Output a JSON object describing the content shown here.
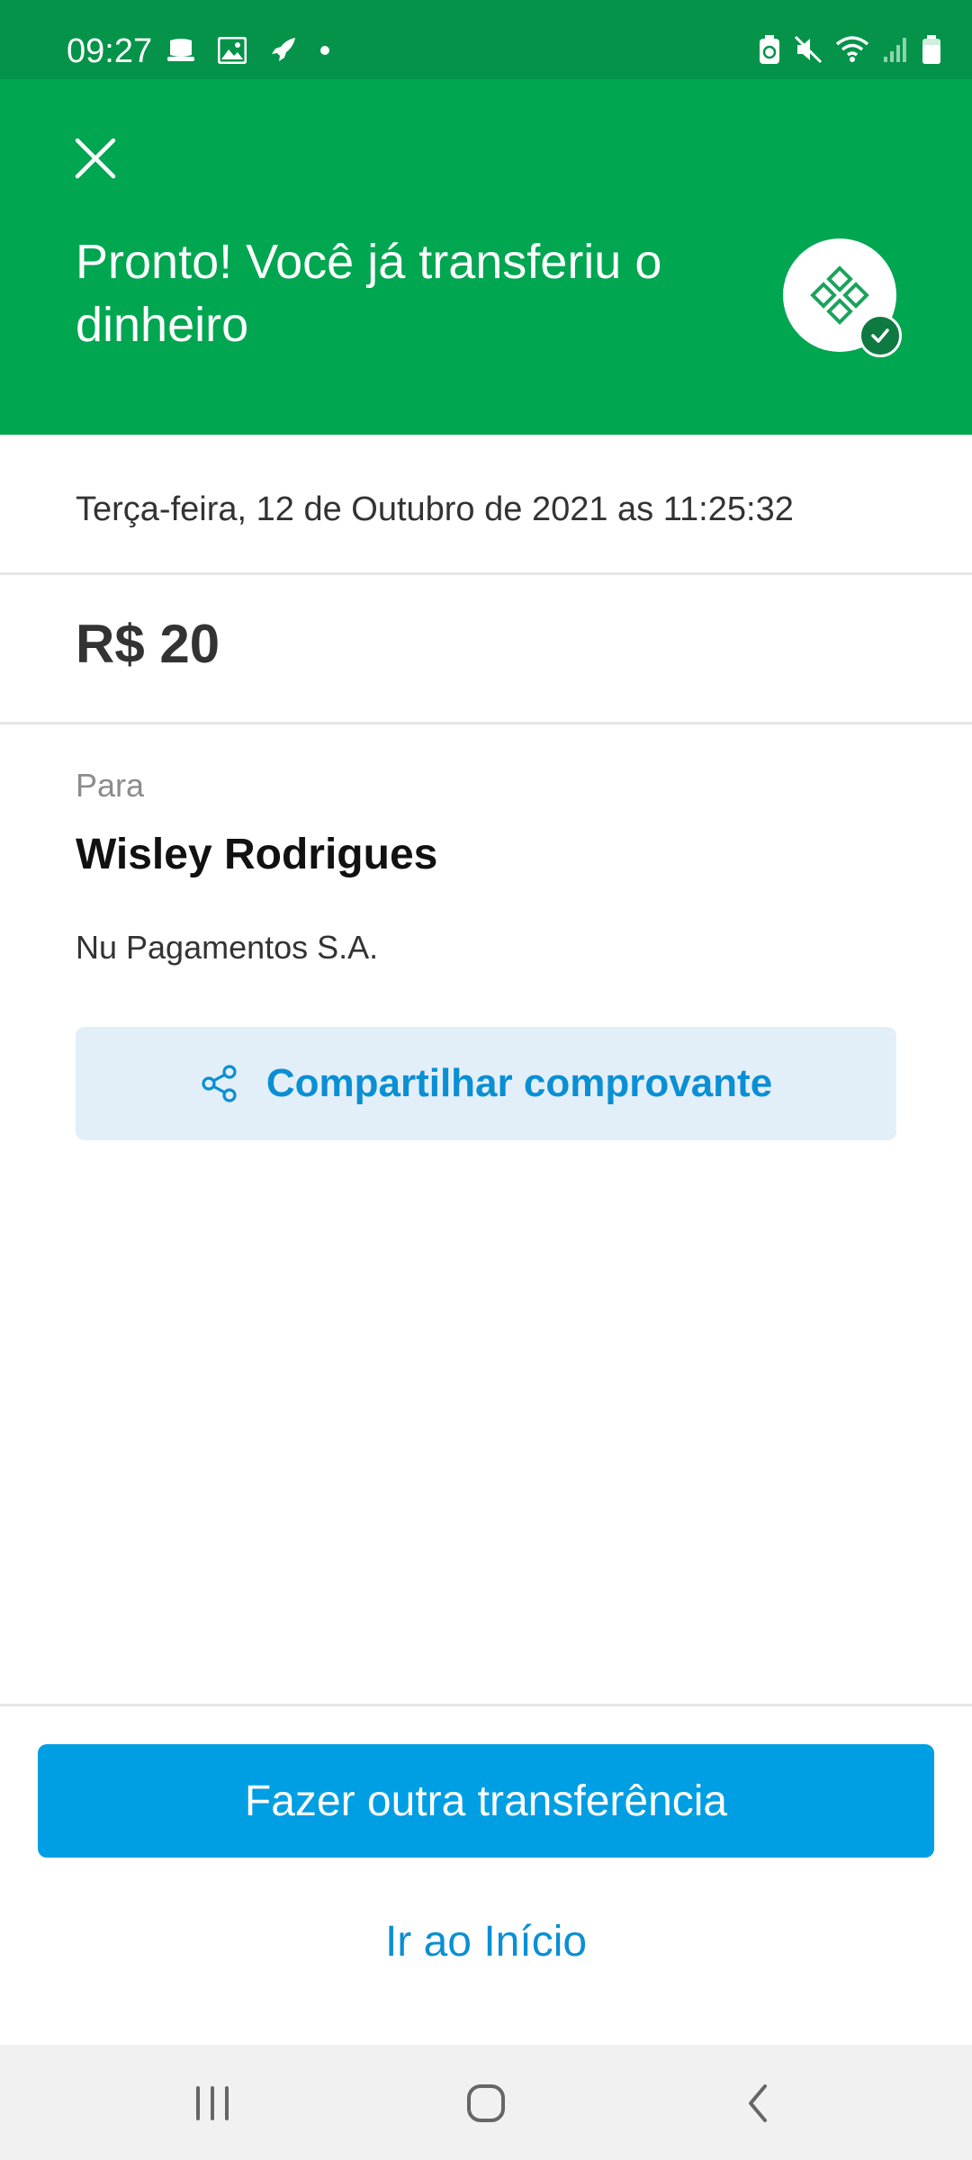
{
  "status_bar": {
    "time": "09:27",
    "left_icons": [
      "hat-notification-icon",
      "image-icon",
      "rocket-icon",
      "dot-icon"
    ],
    "right_icons": [
      "battery-saver-icon",
      "mute-icon",
      "wifi-icon",
      "signal-icon",
      "battery-icon"
    ]
  },
  "header": {
    "title": "Pronto! Você já transferiu o dinheiro",
    "close_icon": "close-icon",
    "logo_icon": "pix-logo-icon",
    "badge_icon": "check-icon",
    "background_color": "#00a650"
  },
  "transfer": {
    "date": "Terça-feira, 12 de Outubro de 2021 as 11:25:32",
    "amount": "R$ 20",
    "to_label": "Para",
    "recipient_name": "Wisley Rodrigues",
    "bank": "Nu Pagamentos S.A.",
    "share_label": "Compartilhar comprovante",
    "share_icon": "share-icon"
  },
  "actions": {
    "primary_label": "Fazer outra transferência",
    "secondary_label": "Ir ao Início",
    "primary_color": "#009ee3",
    "link_color": "#0a8fd4"
  },
  "nav_bar": {
    "items": [
      "recent-apps-icon",
      "home-icon",
      "back-icon"
    ]
  }
}
